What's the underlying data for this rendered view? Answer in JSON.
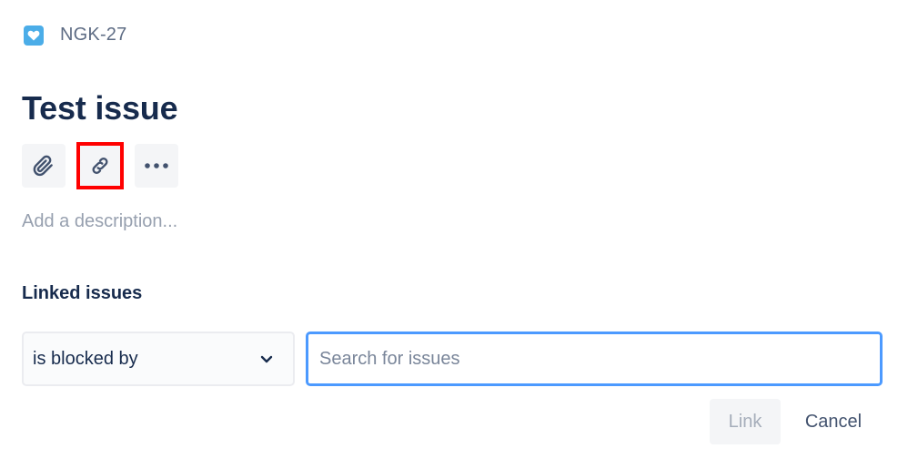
{
  "issue": {
    "type_icon": "heart-icon",
    "key": "NGK-27",
    "title": "Test issue",
    "description_placeholder": "Add a description..."
  },
  "toolbar": {
    "attach_icon": "paperclip-icon",
    "link_icon": "link-icon",
    "more_icon": "ellipsis-icon"
  },
  "linked_issues": {
    "title": "Linked issues",
    "relation_value": "is blocked by",
    "search_placeholder": "Search for issues",
    "link_label": "Link",
    "cancel_label": "Cancel"
  },
  "colors": {
    "accent_blue": "#4c9aff",
    "highlight_red": "#ff0000",
    "issue_type": "#4bade8"
  }
}
